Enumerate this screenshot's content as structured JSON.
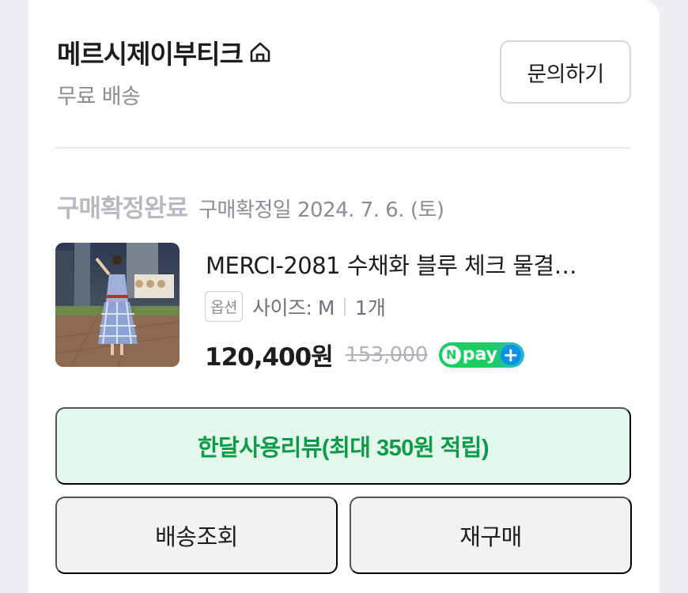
{
  "store": {
    "name": "메르시제이부티크",
    "shipping": "무료 배송",
    "inquiry_label": "문의하기"
  },
  "order": {
    "status": "구매확정완료",
    "confirm_date": "구매확정일 2024. 7. 6. (토)",
    "product": {
      "title": "MERCI-2081 수채화 블루 체크 물결…",
      "option_badge": "옵션",
      "option_value": "사이즈: M",
      "quantity": "1개",
      "price": "120,400원",
      "original_price": "153,000",
      "pay_badge": "pay"
    }
  },
  "actions": {
    "review_label": "한달사용리뷰(최대 350원 적립)",
    "track_label": "배송조회",
    "rebuy_label": "재구매"
  },
  "colors": {
    "accent_green": "#0d9b4a",
    "review_bg": "#e3f7ec",
    "npay_green": "#19ce60"
  }
}
